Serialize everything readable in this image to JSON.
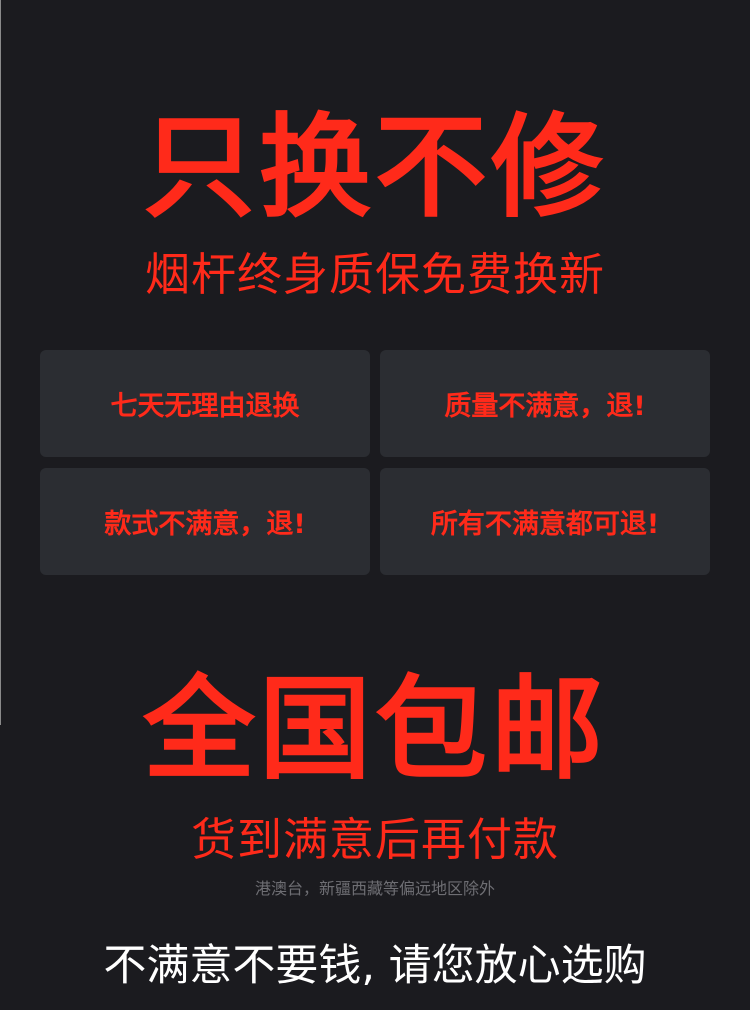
{
  "colors": {
    "background": "#1b1b1f",
    "card_background": "#2b2d32",
    "accent_red": "#ff2a1a",
    "slogan_white": "#ffffff",
    "footnote_gray": "#6e6e73"
  },
  "section1": {
    "headline": "只换不修",
    "subline": "烟杆终身质保免费换新"
  },
  "cards": [
    {
      "label": "七天无理由退换"
    },
    {
      "label": "质量不满意，退!"
    },
    {
      "label": "款式不满意，退!"
    },
    {
      "label": "所有不满意都可退!"
    }
  ],
  "section2": {
    "headline": "全国包邮",
    "subline": "货到满意后再付款",
    "footnote": "港澳台，新疆西藏等偏远地区除外"
  },
  "slogan": "不满意不要钱, 请您放心选购"
}
